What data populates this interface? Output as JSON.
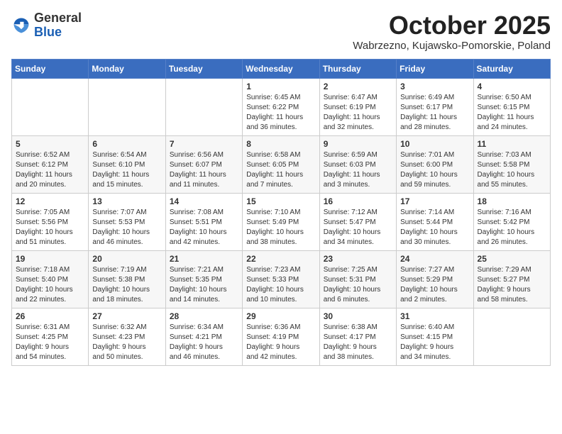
{
  "header": {
    "logo_general": "General",
    "logo_blue": "Blue",
    "title": "October 2025",
    "subtitle": "Wabrzezno, Kujawsko-Pomorskie, Poland"
  },
  "weekdays": [
    "Sunday",
    "Monday",
    "Tuesday",
    "Wednesday",
    "Thursday",
    "Friday",
    "Saturday"
  ],
  "weeks": [
    [
      {
        "day": "",
        "info": ""
      },
      {
        "day": "",
        "info": ""
      },
      {
        "day": "",
        "info": ""
      },
      {
        "day": "1",
        "info": "Sunrise: 6:45 AM\nSunset: 6:22 PM\nDaylight: 11 hours\nand 36 minutes."
      },
      {
        "day": "2",
        "info": "Sunrise: 6:47 AM\nSunset: 6:19 PM\nDaylight: 11 hours\nand 32 minutes."
      },
      {
        "day": "3",
        "info": "Sunrise: 6:49 AM\nSunset: 6:17 PM\nDaylight: 11 hours\nand 28 minutes."
      },
      {
        "day": "4",
        "info": "Sunrise: 6:50 AM\nSunset: 6:15 PM\nDaylight: 11 hours\nand 24 minutes."
      }
    ],
    [
      {
        "day": "5",
        "info": "Sunrise: 6:52 AM\nSunset: 6:12 PM\nDaylight: 11 hours\nand 20 minutes."
      },
      {
        "day": "6",
        "info": "Sunrise: 6:54 AM\nSunset: 6:10 PM\nDaylight: 11 hours\nand 15 minutes."
      },
      {
        "day": "7",
        "info": "Sunrise: 6:56 AM\nSunset: 6:07 PM\nDaylight: 11 hours\nand 11 minutes."
      },
      {
        "day": "8",
        "info": "Sunrise: 6:58 AM\nSunset: 6:05 PM\nDaylight: 11 hours\nand 7 minutes."
      },
      {
        "day": "9",
        "info": "Sunrise: 6:59 AM\nSunset: 6:03 PM\nDaylight: 11 hours\nand 3 minutes."
      },
      {
        "day": "10",
        "info": "Sunrise: 7:01 AM\nSunset: 6:00 PM\nDaylight: 10 hours\nand 59 minutes."
      },
      {
        "day": "11",
        "info": "Sunrise: 7:03 AM\nSunset: 5:58 PM\nDaylight: 10 hours\nand 55 minutes."
      }
    ],
    [
      {
        "day": "12",
        "info": "Sunrise: 7:05 AM\nSunset: 5:56 PM\nDaylight: 10 hours\nand 51 minutes."
      },
      {
        "day": "13",
        "info": "Sunrise: 7:07 AM\nSunset: 5:53 PM\nDaylight: 10 hours\nand 46 minutes."
      },
      {
        "day": "14",
        "info": "Sunrise: 7:08 AM\nSunset: 5:51 PM\nDaylight: 10 hours\nand 42 minutes."
      },
      {
        "day": "15",
        "info": "Sunrise: 7:10 AM\nSunset: 5:49 PM\nDaylight: 10 hours\nand 38 minutes."
      },
      {
        "day": "16",
        "info": "Sunrise: 7:12 AM\nSunset: 5:47 PM\nDaylight: 10 hours\nand 34 minutes."
      },
      {
        "day": "17",
        "info": "Sunrise: 7:14 AM\nSunset: 5:44 PM\nDaylight: 10 hours\nand 30 minutes."
      },
      {
        "day": "18",
        "info": "Sunrise: 7:16 AM\nSunset: 5:42 PM\nDaylight: 10 hours\nand 26 minutes."
      }
    ],
    [
      {
        "day": "19",
        "info": "Sunrise: 7:18 AM\nSunset: 5:40 PM\nDaylight: 10 hours\nand 22 minutes."
      },
      {
        "day": "20",
        "info": "Sunrise: 7:19 AM\nSunset: 5:38 PM\nDaylight: 10 hours\nand 18 minutes."
      },
      {
        "day": "21",
        "info": "Sunrise: 7:21 AM\nSunset: 5:35 PM\nDaylight: 10 hours\nand 14 minutes."
      },
      {
        "day": "22",
        "info": "Sunrise: 7:23 AM\nSunset: 5:33 PM\nDaylight: 10 hours\nand 10 minutes."
      },
      {
        "day": "23",
        "info": "Sunrise: 7:25 AM\nSunset: 5:31 PM\nDaylight: 10 hours\nand 6 minutes."
      },
      {
        "day": "24",
        "info": "Sunrise: 7:27 AM\nSunset: 5:29 PM\nDaylight: 10 hours\nand 2 minutes."
      },
      {
        "day": "25",
        "info": "Sunrise: 7:29 AM\nSunset: 5:27 PM\nDaylight: 9 hours\nand 58 minutes."
      }
    ],
    [
      {
        "day": "26",
        "info": "Sunrise: 6:31 AM\nSunset: 4:25 PM\nDaylight: 9 hours\nand 54 minutes."
      },
      {
        "day": "27",
        "info": "Sunrise: 6:32 AM\nSunset: 4:23 PM\nDaylight: 9 hours\nand 50 minutes."
      },
      {
        "day": "28",
        "info": "Sunrise: 6:34 AM\nSunset: 4:21 PM\nDaylight: 9 hours\nand 46 minutes."
      },
      {
        "day": "29",
        "info": "Sunrise: 6:36 AM\nSunset: 4:19 PM\nDaylight: 9 hours\nand 42 minutes."
      },
      {
        "day": "30",
        "info": "Sunrise: 6:38 AM\nSunset: 4:17 PM\nDaylight: 9 hours\nand 38 minutes."
      },
      {
        "day": "31",
        "info": "Sunrise: 6:40 AM\nSunset: 4:15 PM\nDaylight: 9 hours\nand 34 minutes."
      },
      {
        "day": "",
        "info": ""
      }
    ]
  ]
}
